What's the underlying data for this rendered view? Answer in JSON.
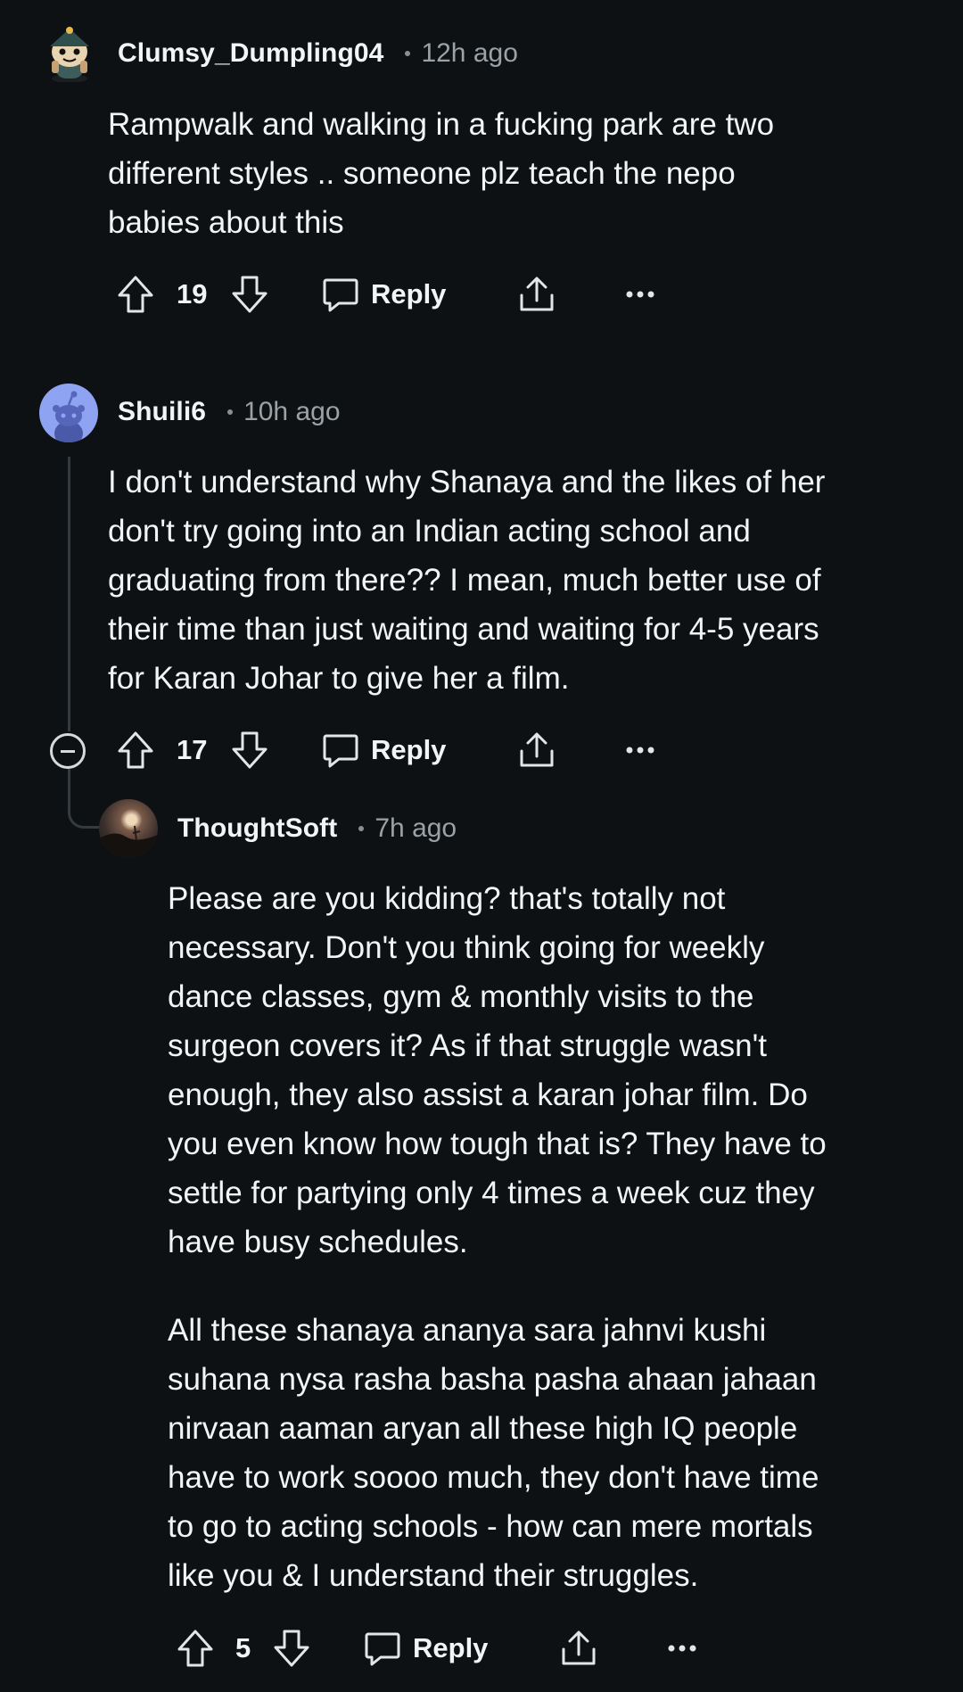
{
  "comments": [
    {
      "username": "Clumsy_Dumpling04",
      "time": "12h ago",
      "body": "Rampwalk and walking in a fucking park are two\ndifferent styles .. someone plz teach the nepo\nbabies about this",
      "votes": "19",
      "reply_label": "Reply"
    },
    {
      "username": "Shuili6",
      "time": "10h ago",
      "body": "I don't understand why Shanaya and the likes of her\ndon't try going into an Indian acting school and\ngraduating from there?? I mean, much better use of\ntheir time than just waiting and waiting for 4-5 years\nfor Karan Johar to give her  a film.",
      "votes": "17",
      "reply_label": "Reply"
    },
    {
      "username": "ThoughtSoft",
      "time": "7h ago",
      "body": "Please are you kidding? that's totally not\nnecessary. Don't you think going for weekly\ndance classes, gym & monthly visits to the\nsurgeon covers it? As if that struggle wasn't\nenough, they also assist a karan johar film. Do\nyou even know how tough that is? They have to\nsettle for partying only 4 times a week cuz they\nhave busy schedules.",
      "body2": "All these shanaya ananya sara jahnvi kushi\nsuhana nysa rasha basha pasha ahaan jahaan\nnirvaan aaman aryan all these high IQ people\nhave to work soooo much, they don't have time\nto go to acting schools - how can mere mortals\nlike you & I understand their struggles.",
      "votes": "5",
      "reply_label": "Reply"
    }
  ],
  "icons": {
    "upvote": "upvote-icon",
    "downvote": "downvote-icon",
    "reply": "speech-bubble-icon",
    "share": "share-icon",
    "more": "more-options-icon",
    "collapse": "collapse-thread-icon"
  },
  "colors": {
    "background": "#0e1113",
    "text": "#f2f4f5",
    "muted": "#9ba1a5",
    "thread_line": "#343a3e",
    "shuili_avatar_bg": "#8ea3f2"
  }
}
